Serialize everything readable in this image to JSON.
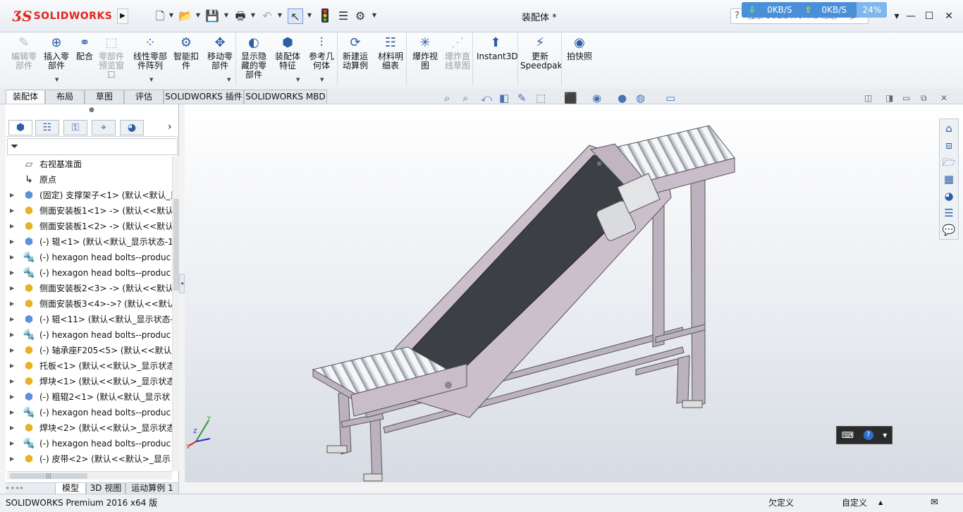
{
  "app": {
    "logo_text": "SOLIDWORKS",
    "window_title": "装配体 *",
    "search_placeholder": "搜索 SOLIDWORKS 帮助",
    "network": {
      "down": "0KB/S",
      "up": "0KB/S",
      "percent": "24%"
    }
  },
  "ribbon": {
    "items": [
      {
        "label": "编辑零\n部件",
        "icon": "edit-component-icon",
        "enabled": false
      },
      {
        "label": "插入零\n部件",
        "icon": "insert-components-icon",
        "enabled": true
      },
      {
        "label": "配合",
        "icon": "mate-icon",
        "enabled": true
      },
      {
        "label": "零部件\n预览窗\n口",
        "icon": "component-preview-icon",
        "enabled": false
      },
      {
        "label": "线性零部\n件阵列",
        "icon": "linear-pattern-icon",
        "enabled": true
      },
      {
        "label": "智能扣\n件",
        "icon": "smart-fasteners-icon",
        "enabled": true
      },
      {
        "label": "移动零\n部件",
        "icon": "move-component-icon",
        "enabled": true
      },
      {
        "label": "显示隐\n藏的零\n部件",
        "icon": "show-hidden-icon",
        "enabled": true
      },
      {
        "label": "装配体\n特征",
        "icon": "assembly-features-icon",
        "enabled": true
      },
      {
        "label": "参考几\n何体",
        "icon": "reference-geometry-icon",
        "enabled": true
      },
      {
        "label": "新建运\n动算例",
        "icon": "new-motion-study-icon",
        "enabled": true
      },
      {
        "label": "材料明\n细表",
        "icon": "bill-of-materials-icon",
        "enabled": true
      },
      {
        "label": "爆炸视\n图",
        "icon": "exploded-view-icon",
        "enabled": true
      },
      {
        "label": "爆炸直\n线草图",
        "icon": "explode-line-sketch-icon",
        "enabled": false
      },
      {
        "label": "Instant3D",
        "icon": "instant3d-icon",
        "enabled": true
      },
      {
        "label": "更新\nSpeedpak",
        "icon": "update-speedpak-icon",
        "enabled": true
      },
      {
        "label": "拍快照",
        "icon": "take-snapshot-icon",
        "enabled": true
      }
    ]
  },
  "tabs": [
    "装配体",
    "布局",
    "草图",
    "评估",
    "SOLIDWORKS 插件",
    "SOLIDWORKS MBD"
  ],
  "tree": {
    "rows": [
      {
        "kind": "plane",
        "text": "右视基准面",
        "expandable": false
      },
      {
        "kind": "origin",
        "text": "原点",
        "expandable": false
      },
      {
        "kind": "asm",
        "text": "(固定) 支撑架子<1> (默认<默认_显",
        "expandable": true
      },
      {
        "kind": "part",
        "text": "侧面安装板1<1> -> (默认<<默认",
        "expandable": true
      },
      {
        "kind": "part",
        "text": "侧面安装板1<2> -> (默认<<默认",
        "expandable": true
      },
      {
        "kind": "asm",
        "text": "(-) 辊<1> (默认<默认_显示状态-1",
        "expandable": true
      },
      {
        "kind": "bolt",
        "text": "(-) hexagon head bolts--produc",
        "expandable": true
      },
      {
        "kind": "bolt",
        "text": "(-) hexagon head bolts--produc",
        "expandable": true
      },
      {
        "kind": "part",
        "text": "侧面安装板2<3> -> (默认<<默认",
        "expandable": true
      },
      {
        "kind": "part",
        "text": "侧面安装板3<4>->? (默认<<默认",
        "expandable": true
      },
      {
        "kind": "asm",
        "text": "(-) 辊<11> (默认<默认_显示状态-",
        "expandable": true
      },
      {
        "kind": "bolt",
        "text": "(-) hexagon head bolts--produc",
        "expandable": true
      },
      {
        "kind": "part",
        "text": "(-) 轴承座F205<5> (默认<<默认:",
        "expandable": true
      },
      {
        "kind": "part",
        "text": "托板<1> (默认<<默认>_显示状态",
        "expandable": true
      },
      {
        "kind": "part",
        "text": "焊块<1> (默认<<默认>_显示状态",
        "expandable": true
      },
      {
        "kind": "asm",
        "text": "(-) 粗辊2<1> (默认<默认_显示状",
        "expandable": true
      },
      {
        "kind": "bolt",
        "text": "(-) hexagon head bolts--produc",
        "expandable": true
      },
      {
        "kind": "part",
        "text": "焊块<2> (默认<<默认>_显示状态",
        "expandable": true
      },
      {
        "kind": "bolt",
        "text": "(-) hexagon head bolts--produc",
        "expandable": true
      },
      {
        "kind": "part",
        "text": "(-) 皮带<2> (默认<<默认>_显示",
        "expandable": true
      }
    ]
  },
  "bottom_tabs": [
    "模型",
    "3D 视图",
    "运动算例 1"
  ],
  "status": {
    "product": "SOLIDWORKS Premium 2016 x64 版",
    "state": "欠定义",
    "custom": "自定义"
  }
}
